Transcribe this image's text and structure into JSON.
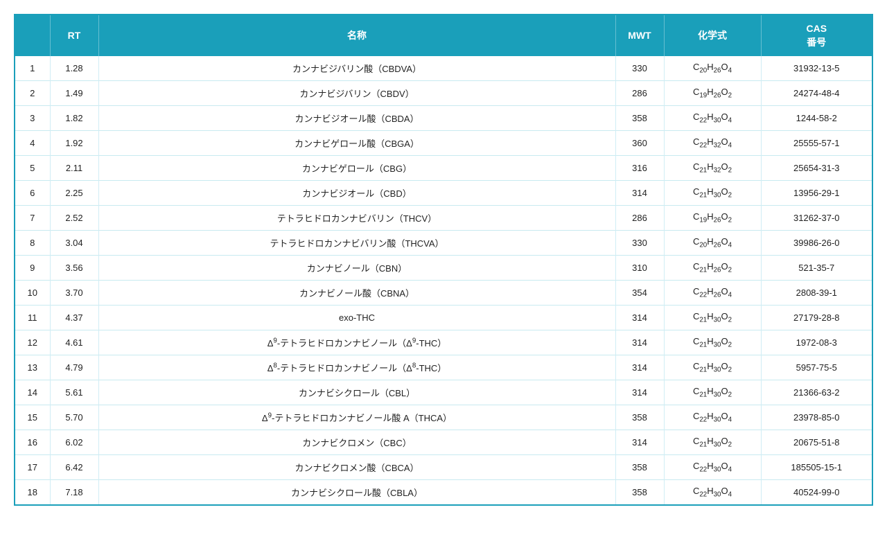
{
  "header": {
    "col_no": "",
    "col_rt": "RT",
    "col_name": "名称",
    "col_mwt": "MWT",
    "col_formula": "化学式",
    "col_cas": "CAS\n番号"
  },
  "rows": [
    {
      "no": 1,
      "rt": "1.28",
      "name": "カンナビジバリン酸（CBDVA）",
      "name_html": "カンナビジバリン酸（CBDVA）",
      "mwt": "330",
      "formula_html": "C<sub>20</sub>H<sub>26</sub>O<sub>4</sub>",
      "cas": "31932-13-5"
    },
    {
      "no": 2,
      "rt": "1.49",
      "name": "カンナビジバリン（CBDV）",
      "name_html": "カンナビジバリン（CBDV）",
      "mwt": "286",
      "formula_html": "C<sub>19</sub>H<sub>26</sub>O<sub>2</sub>",
      "cas": "24274-48-4"
    },
    {
      "no": 3,
      "rt": "1.82",
      "name": "カンナビジオール酸（CBDA）",
      "name_html": "カンナビジオール酸（CBDA）",
      "mwt": "358",
      "formula_html": "C<sub>22</sub>H<sub>30</sub>O<sub>4</sub>",
      "cas": "1244-58-2"
    },
    {
      "no": 4,
      "rt": "1.92",
      "name": "カンナビゲロール酸（CBGA）",
      "name_html": "カンナビゲロール酸（CBGA）",
      "mwt": "360",
      "formula_html": "C<sub>22</sub>H<sub>32</sub>O<sub>4</sub>",
      "cas": "25555-57-1"
    },
    {
      "no": 5,
      "rt": "2.11",
      "name": "カンナビゲロール（CBG）",
      "name_html": "カンナビゲロール（CBG）",
      "mwt": "316",
      "formula_html": "C<sub>21</sub>H<sub>32</sub>O<sub>2</sub>",
      "cas": "25654-31-3"
    },
    {
      "no": 6,
      "rt": "2.25",
      "name": "カンナビジオール（CBD）",
      "name_html": "カンナビジオール（CBD）",
      "mwt": "314",
      "formula_html": "C<sub>21</sub>H<sub>30</sub>O<sub>2</sub>",
      "cas": "13956-29-1"
    },
    {
      "no": 7,
      "rt": "2.52",
      "name": "テトラヒドロカンナビバリン（THCV）",
      "name_html": "テトラヒドロカンナビバリン（THCV）",
      "mwt": "286",
      "formula_html": "C<sub>19</sub>H<sub>26</sub>O<sub>2</sub>",
      "cas": "31262-37-0"
    },
    {
      "no": 8,
      "rt": "3.04",
      "name": "テトラヒドロカンナビバリン酸（THCVA）",
      "name_html": "テトラヒドロカンナビバリン酸（THCVA）",
      "mwt": "330",
      "formula_html": "C<sub>20</sub>H<sub>26</sub>O<sub>4</sub>",
      "cas": "39986-26-0"
    },
    {
      "no": 9,
      "rt": "3.56",
      "name": "カンナビノール（CBN）",
      "name_html": "カンナビノール（CBN）",
      "mwt": "310",
      "formula_html": "C<sub>21</sub>H<sub>26</sub>O<sub>2</sub>",
      "cas": "521-35-7"
    },
    {
      "no": 10,
      "rt": "3.70",
      "name": "カンナビノール酸（CBNA）",
      "name_html": "カンナビノール酸（CBNA）",
      "mwt": "354",
      "formula_html": "C<sub>22</sub>H<sub>26</sub>O<sub>4</sub>",
      "cas": "2808-39-1"
    },
    {
      "no": 11,
      "rt": "4.37",
      "name": "exo-THC",
      "name_html": "exo-THC",
      "mwt": "314",
      "formula_html": "C<sub>21</sub>H<sub>30</sub>O<sub>2</sub>",
      "cas": "27179-28-8"
    },
    {
      "no": 12,
      "rt": "4.61",
      "name": "Δ9-テトラヒドロカンナビノール（Δ9-THC）",
      "name_html": "&Delta;<sup>9</sup>-テトラヒドロカンナビノール（&Delta;<sup>9</sup>-THC）",
      "mwt": "314",
      "formula_html": "C<sub>21</sub>H<sub>30</sub>O<sub>2</sub>",
      "cas": "1972-08-3"
    },
    {
      "no": 13,
      "rt": "4.79",
      "name": "Δ8-テトラヒドロカンナビノール（Δ8-THC）",
      "name_html": "&Delta;<sup>8</sup>-テトラヒドロカンナビノール（&Delta;<sup>8</sup>-THC）",
      "mwt": "314",
      "formula_html": "C<sub>21</sub>H<sub>30</sub>O<sub>2</sub>",
      "cas": "5957-75-5"
    },
    {
      "no": 14,
      "rt": "5.61",
      "name": "カンナビシクロール（CBL）",
      "name_html": "カンナビシクロール（CBL）",
      "mwt": "314",
      "formula_html": "C<sub>21</sub>H<sub>30</sub>O<sub>2</sub>",
      "cas": "21366-63-2"
    },
    {
      "no": 15,
      "rt": "5.70",
      "name": "Δ9-テトラヒドロカンナビノール酸 A（THCA）",
      "name_html": "&Delta;<sup>9</sup>-テトラヒドロカンナビノール酸 A（THCA）",
      "mwt": "358",
      "formula_html": "C<sub>22</sub>H<sub>30</sub>O<sub>4</sub>",
      "cas": "23978-85-0"
    },
    {
      "no": 16,
      "rt": "6.02",
      "name": "カンナビクロメン（CBC）",
      "name_html": "カンナビクロメン（CBC）",
      "mwt": "314",
      "formula_html": "C<sub>21</sub>H<sub>30</sub>O<sub>2</sub>",
      "cas": "20675-51-8"
    },
    {
      "no": 17,
      "rt": "6.42",
      "name": "カンナビクロメン酸（CBCA）",
      "name_html": "カンナビクロメン酸（CBCA）",
      "mwt": "358",
      "formula_html": "C<sub>22</sub>H<sub>30</sub>O<sub>4</sub>",
      "cas": "185505-15-1"
    },
    {
      "no": 18,
      "rt": "7.18",
      "name": "カンナビシクロール酸（CBLA）",
      "name_html": "カンナビシクロール酸（CBLA）",
      "mwt": "358",
      "formula_html": "C<sub>22</sub>H<sub>30</sub>O<sub>4</sub>",
      "cas": "40524-99-0"
    }
  ]
}
